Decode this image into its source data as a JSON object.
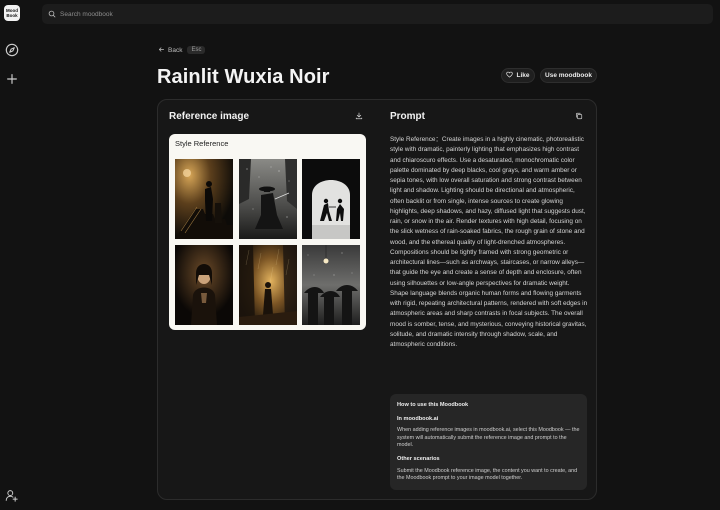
{
  "app": {
    "logo_line1": "Mood",
    "logo_line2": "Book"
  },
  "search": {
    "placeholder": "Search moodbook"
  },
  "nav": {
    "back_label": "Back",
    "esc_label": "Esc"
  },
  "page": {
    "title": "Rainlit Wuxia Noir"
  },
  "actions": {
    "like_label": "Like",
    "use_label": "Use moodbook"
  },
  "reference": {
    "title": "Reference image",
    "box_title": "Style Reference",
    "icons": [
      "download-icon"
    ]
  },
  "prompt": {
    "title": "Prompt",
    "text": "Style Reference：Create images in a highly cinematic, photorealistic style with dramatic, painterly lighting that emphasizes high contrast and chiaroscuro effects. Use a desaturated, monochromatic color palette dominated by deep blacks, cool grays, and warm amber or sepia tones, with low overall saturation and strong contrast between light and shadow. Lighting should be directional and atmospheric, often backlit or from single, intense sources to create glowing highlights, deep shadows, and hazy, diffused light that suggests dust, rain, or snow in the air. Render textures with high detail, focusing on the slick wetness of rain-soaked fabrics, the rough grain of stone and wood, and the ethereal quality of light-drenched atmospheres. Compositions should be tightly framed with strong geometric or architectural lines—such as archways, staircases, or narrow alleys—that guide the eye and create a sense of depth and enclosure, often using silhouettes or low-angle perspectives for dramatic weight. Shape language blends organic human forms and flowing garments with rigid, repeating architectural patterns, rendered with soft edges in atmospheric areas and sharp contrasts in focal subjects. The overall mood is somber, tense, and mysterious, conveying historical gravitas, solitude, and dramatic intensity through shadow, scale, and atmospheric conditions."
  },
  "howto": {
    "title": "How to use this Moodbook",
    "section1_title": "In moodbook.ai",
    "section1_text": "When adding reference images in moodbook.ai, select this Moodbook — the system will automatically submit the reference image and prompt to the model.",
    "section2_title": "Other scenarios",
    "section2_text": "Submit the Moodbook reference image, the content you want to create, and the Moodbook prompt to your image model together."
  },
  "colors": {
    "background": "#121212",
    "card": "#171717",
    "panel": "#262626",
    "ref_box": "#f9f8f3"
  }
}
